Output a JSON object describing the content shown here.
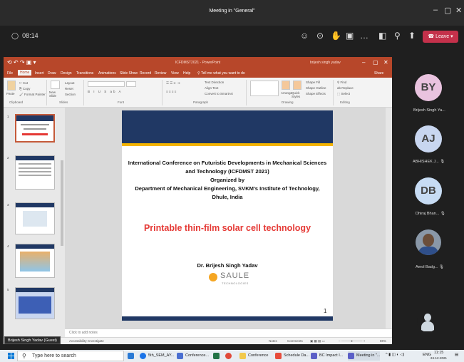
{
  "window": {
    "title": "Meeting in \"General\""
  },
  "controls": {
    "timer": "08:14",
    "leave_label": "Leave"
  },
  "powerpoint": {
    "doc_title": "ICFDMST2021 - PowerPoint",
    "user": "brijesh singh yadav",
    "menus": [
      "File",
      "Home",
      "Insert",
      "Draw",
      "Design",
      "Transitions",
      "Animations",
      "Slide Show",
      "Record",
      "Review",
      "View",
      "Help",
      "Tell me what you want to do",
      "Share"
    ],
    "active_menu": "Home",
    "ribbon_groups": [
      "Clipboard",
      "Slides",
      "Font",
      "Paragraph",
      "Drawing",
      "Editing"
    ],
    "ribbon_text": {
      "paste": "Paste",
      "new_slide": "New Slide",
      "layout": "Layout",
      "reset": "Reset",
      "section": "Section",
      "arrange": "Arrange",
      "quick_styles": "Quick Styles",
      "find": "Find",
      "replace": "Replace",
      "select": "Select"
    },
    "slide_numbers": [
      "1",
      "2",
      "3",
      "4",
      "5"
    ],
    "notes_placeholder": "Click to add notes",
    "status": {
      "accessibility": "Accessibility: Investigate",
      "notes": "Notes",
      "comments": "Comments",
      "zoom": "86%"
    }
  },
  "slide": {
    "conference_lines": [
      "International Conference on Futuristic Developments in Mechanical Sciences",
      "and Technology (ICFDMST 2021)",
      "Organized by",
      "Department of Mechanical Engineering, SVKM's Institute of Technology,",
      "Dhule, India"
    ],
    "title": "Printable thin-film solar cell technology",
    "author": "Dr. Brijesh Singh Yadav",
    "logo_name": "SAULE",
    "logo_sub": "TECHNOLOGIES",
    "number": "1"
  },
  "presenter_tag": "Brijesh Singh Yadav (Guest)",
  "participants": [
    {
      "initials": "BY",
      "name": "Brijesh Singh Ya...",
      "color": "#e9c3df"
    },
    {
      "initials": "AJ",
      "name": "ABHISHEK J...",
      "color": "#c8d6f0"
    },
    {
      "initials": "DB",
      "name": "Dhiraj Bhan...",
      "color": "#c7dcf4"
    },
    {
      "initials": "",
      "name": "Amol Badg..."
    }
  ],
  "taskbar": {
    "search_placeholder": "Type here to search",
    "apps": [
      "5th_SEM_AY...",
      "Conference...",
      "Conference",
      "Schedule Da...",
      "BC Impact I...",
      "Meeting in \"..."
    ],
    "lang": "ENG",
    "time": "11:15",
    "date": "24-12-2021"
  },
  "colors": {
    "ppt_accent": "#b7472a",
    "leave": "#c4314b",
    "slide_title": "#e53935",
    "slide_band": "#203864"
  }
}
